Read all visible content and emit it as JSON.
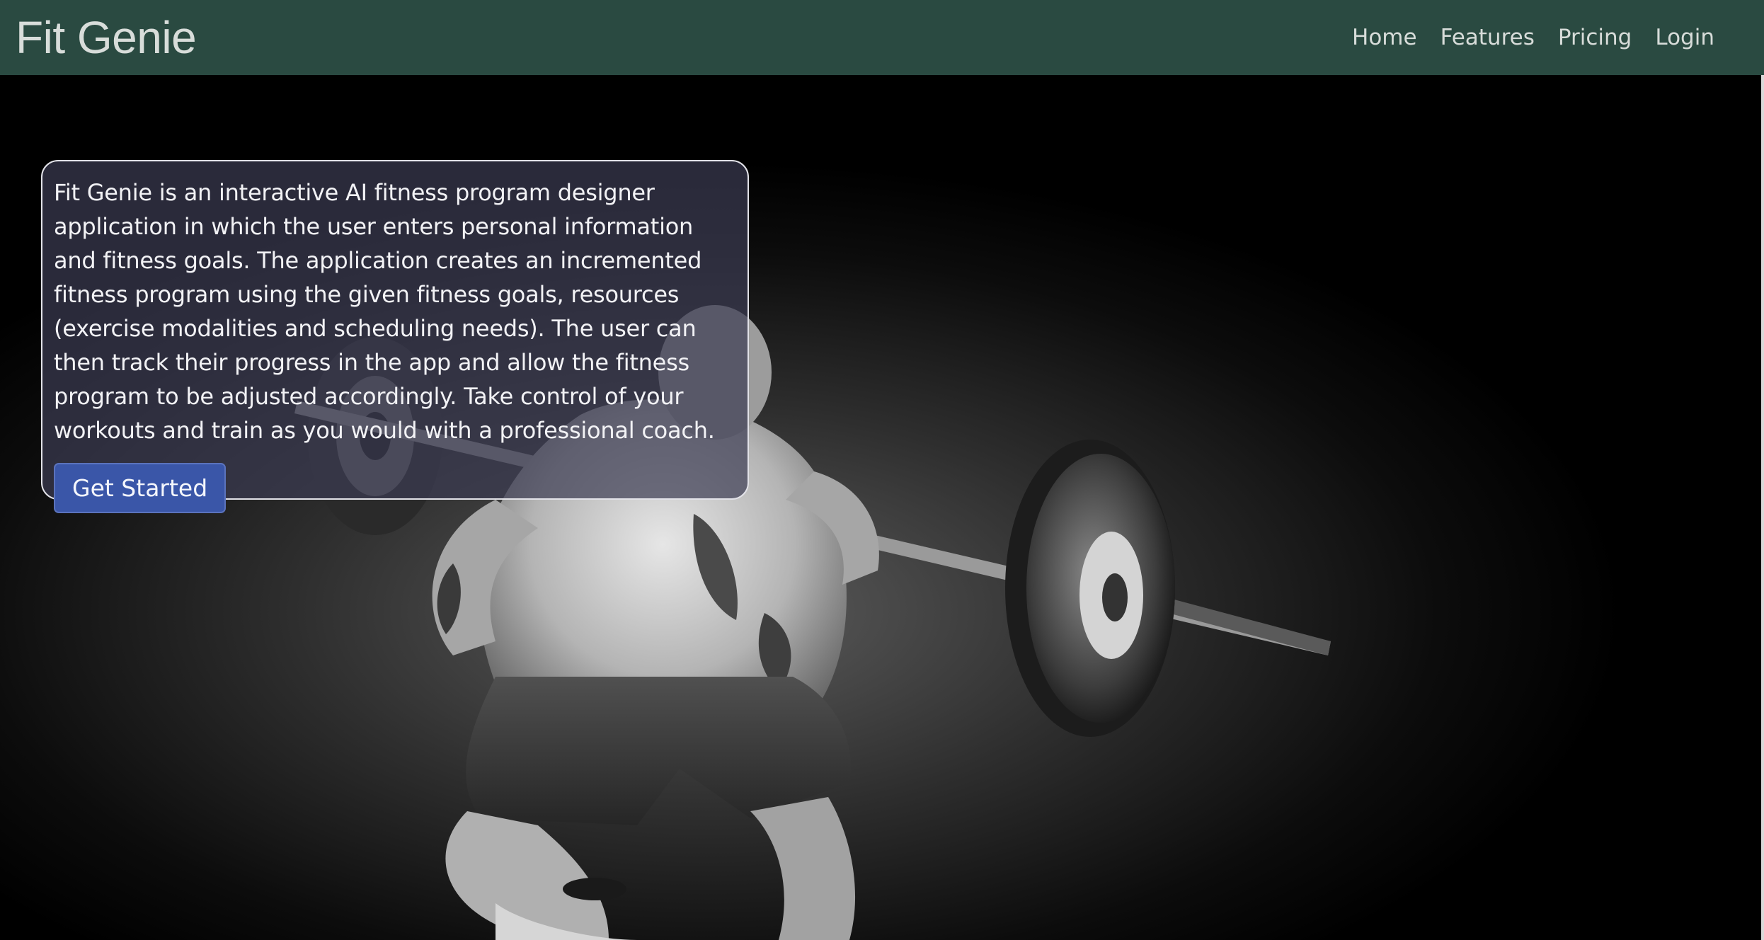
{
  "navbar": {
    "brand": "Fit Genie",
    "links": [
      {
        "label": "Home"
      },
      {
        "label": "Features"
      },
      {
        "label": "Pricing"
      },
      {
        "label": "Login"
      }
    ],
    "background_color": "#2a4a41"
  },
  "hero": {
    "description": "Fit Genie is an interactive AI fitness program designer application in which the user enters personal information and fitness goals. The application creates an incremented fitness program using the given fitness goals, resources (exercise modalities and scheduling needs). The user can then track their progress in the app and allow the fitness program to be adjusted accordingly. Take control of your workouts and train as you would with a professional coach.",
    "cta_label": "Get Started",
    "cta_color": "#3a56a8"
  }
}
